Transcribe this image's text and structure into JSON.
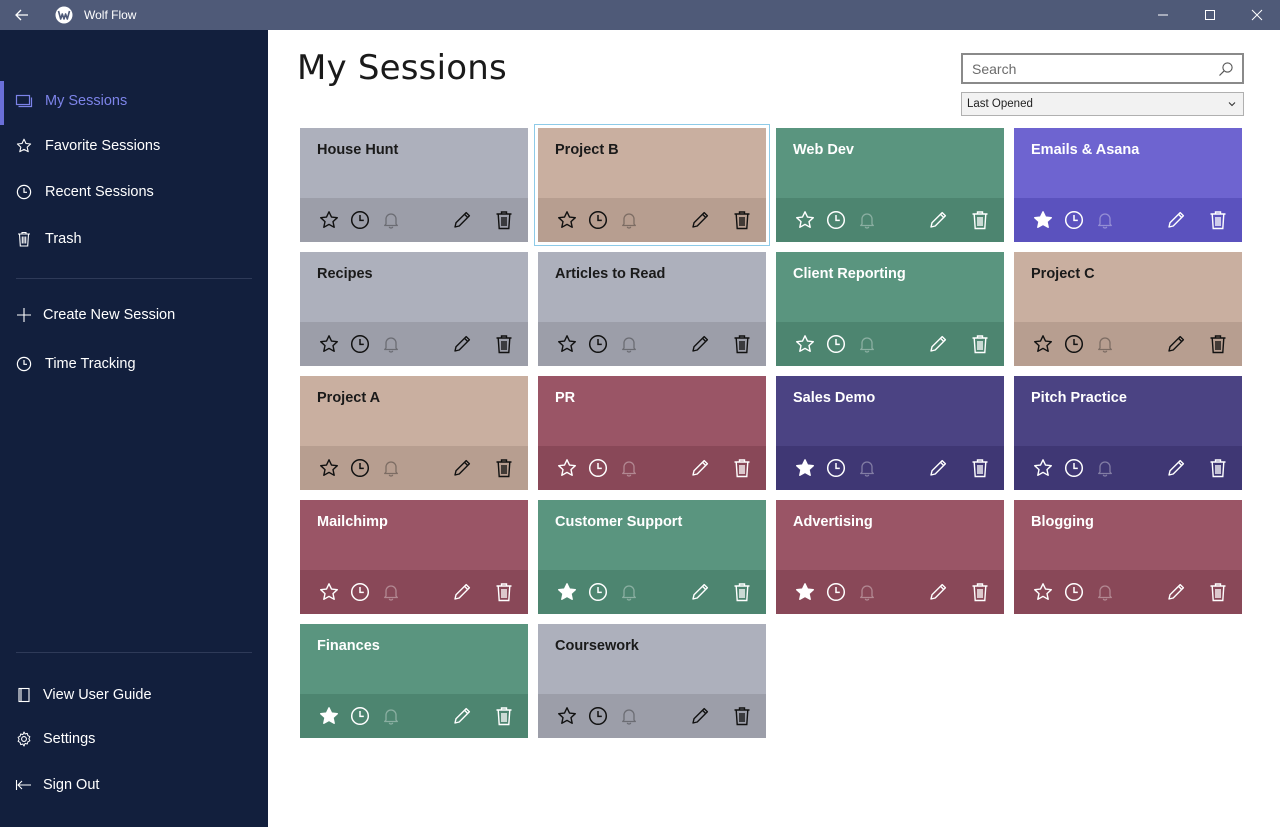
{
  "window": {
    "title": "Wolf Flow"
  },
  "sidebar": {
    "items": [
      {
        "label": "My Sessions",
        "icon": "sessions-icon"
      },
      {
        "label": "Favorite Sessions",
        "icon": "star-icon"
      },
      {
        "label": "Recent Sessions",
        "icon": "clock-icon"
      },
      {
        "label": "Trash",
        "icon": "trash-icon"
      }
    ],
    "actions": [
      {
        "label": "Create New Session",
        "icon": "plus-icon"
      },
      {
        "label": "Time Tracking",
        "icon": "clock-icon"
      }
    ],
    "footer": [
      {
        "label": "View User Guide",
        "icon": "book-icon"
      },
      {
        "label": "Settings",
        "icon": "gear-icon"
      },
      {
        "label": "Sign Out",
        "icon": "sign-out-icon"
      }
    ]
  },
  "main": {
    "title": "My Sessions",
    "search": {
      "placeholder": "Search"
    },
    "sort": {
      "selected": "Last Opened"
    }
  },
  "colors": {
    "gray": {
      "top": "#adb0bc",
      "bottom": "#9c9ea9",
      "text": "#1a1a1a",
      "icon": "#111111"
    },
    "tan": {
      "top": "#c9afa0",
      "bottom": "#b79e90",
      "text": "#1a1a1a",
      "icon": "#111111"
    },
    "green": {
      "top": "#5a957f",
      "bottom": "#4d8570",
      "text": "#ffffff",
      "icon": "#ffffff"
    },
    "violet": {
      "top": "#6e64d0",
      "bottom": "#5b52be",
      "text": "#ffffff",
      "icon": "#ffffff"
    },
    "rose": {
      "top": "#9a5566",
      "bottom": "#894858",
      "text": "#ffffff",
      "icon": "#ffffff"
    },
    "indigo": {
      "top": "#4b4383",
      "bottom": "#3f3774",
      "text": "#ffffff",
      "icon": "#ffffff"
    }
  },
  "sessions": [
    {
      "name": "House Hunt",
      "color": "gray",
      "favorite": false
    },
    {
      "name": "Project B",
      "color": "tan",
      "favorite": false,
      "selected": true
    },
    {
      "name": "Web Dev",
      "color": "green",
      "favorite": false
    },
    {
      "name": "Emails & Asana",
      "color": "violet",
      "favorite": true
    },
    {
      "name": "Recipes",
      "color": "gray",
      "favorite": false
    },
    {
      "name": "Articles to Read",
      "color": "gray",
      "favorite": false
    },
    {
      "name": "Client Reporting",
      "color": "green",
      "favorite": false
    },
    {
      "name": "Project C",
      "color": "tan",
      "favorite": false
    },
    {
      "name": "Project A",
      "color": "tan",
      "favorite": false
    },
    {
      "name": "PR",
      "color": "rose",
      "favorite": false
    },
    {
      "name": "Sales Demo",
      "color": "indigo",
      "favorite": true
    },
    {
      "name": "Pitch Practice",
      "color": "indigo",
      "favorite": false
    },
    {
      "name": "Mailchimp",
      "color": "rose",
      "favorite": false
    },
    {
      "name": "Customer Support",
      "color": "green",
      "favorite": true
    },
    {
      "name": "Advertising",
      "color": "rose",
      "favorite": true
    },
    {
      "name": "Blogging",
      "color": "rose",
      "favorite": false
    },
    {
      "name": "Finances",
      "color": "green",
      "favorite": true
    },
    {
      "name": "Coursework",
      "color": "gray",
      "favorite": false
    }
  ]
}
